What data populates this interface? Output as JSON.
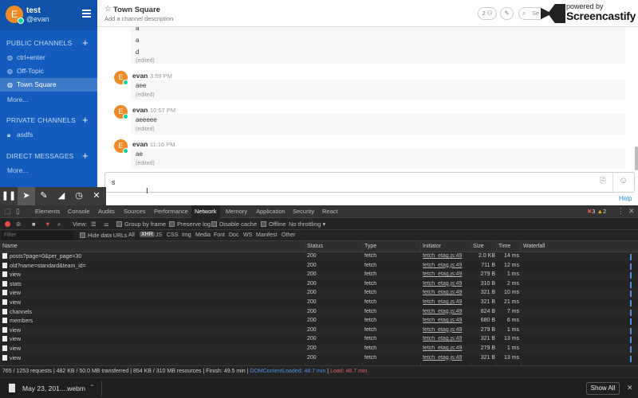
{
  "sidebar": {
    "team": "test",
    "user": "@evan",
    "avatar_letter": "E",
    "public_header": "PUBLIC CHANNELS",
    "public_channels": [
      "ctrl+enter",
      "Off-Topic",
      "Town Square"
    ],
    "private_header": "PRIVATE CHANNELS",
    "private_channels": [
      "asdfs"
    ],
    "direct_header": "DIRECT MESSAGES",
    "more": "More...",
    "plus": "+"
  },
  "channel": {
    "title": "Town Square",
    "description": "Add a channel description",
    "member_count": "2",
    "search_placeholder": "Se"
  },
  "watermark": {
    "powered": "powered by",
    "name": "Screencastify"
  },
  "posts": {
    "top_lines": [
      "a",
      "a",
      "d"
    ],
    "edited": "(edited)",
    "items": [
      {
        "author": "evan",
        "time": "3:59 PM",
        "text": "aee"
      },
      {
        "author": "evan",
        "time": "10:57 PM",
        "text": "aeeeee"
      },
      {
        "author": "evan",
        "time": "11:16 PM",
        "text": "ae"
      }
    ]
  },
  "composer": {
    "value": "s",
    "help": "Help"
  },
  "devtools": {
    "tabs": [
      "Elements",
      "Console",
      "Audits",
      "Sources",
      "Performance",
      "Network",
      "Memory",
      "Application",
      "Security",
      "React"
    ],
    "active_tab": "Network",
    "errors": "3",
    "warnings": "2",
    "toolbar": {
      "view": "View:",
      "group": "Group by frame",
      "preserve": "Preserve log",
      "disable_cache": "Disable cache",
      "offline": "Offline",
      "throttle": "No throttling"
    },
    "filter_placeholder": "Filter",
    "filter_types": [
      "Hide data URLs",
      "All",
      "XHR",
      "JS",
      "CSS",
      "Img",
      "Media",
      "Font",
      "Doc",
      "WS",
      "Manifest",
      "Other"
    ],
    "columns": [
      "Name",
      "Status",
      "Type",
      "Initiator",
      "Size",
      "Time",
      "Waterfall"
    ],
    "rows": [
      [
        "posts?page=0&per_page=30",
        "200",
        "fetch",
        "fetch_etag.js:49",
        "2.0 KB",
        "14 ms"
      ],
      [
        "old?name=standard&team_id=",
        "200",
        "fetch",
        "fetch_etag.js:49",
        "711 B",
        "12 ms"
      ],
      [
        "view",
        "200",
        "fetch",
        "fetch_etag.js:49",
        "279 B",
        "1 ms"
      ],
      [
        "stats",
        "200",
        "fetch",
        "fetch_etag.js:49",
        "310 B",
        "2 ms"
      ],
      [
        "view",
        "200",
        "fetch",
        "fetch_etag.js:49",
        "321 B",
        "10 ms"
      ],
      [
        "view",
        "200",
        "fetch",
        "fetch_etag.js:49",
        "321 B",
        "21 ms"
      ],
      [
        "channels",
        "200",
        "fetch",
        "fetch_etag.js:49",
        "824 B",
        "7 ms"
      ],
      [
        "members",
        "200",
        "fetch",
        "fetch_etag.js:49",
        "680 B",
        "6 ms"
      ],
      [
        "view",
        "200",
        "fetch",
        "fetch_etag.js:49",
        "279 B",
        "1 ms"
      ],
      [
        "view",
        "200",
        "fetch",
        "fetch_etag.js:49",
        "321 B",
        "13 ms"
      ],
      [
        "view",
        "200",
        "fetch",
        "fetch_etag.js:49",
        "279 B",
        "1 ms"
      ],
      [
        "view",
        "200",
        "fetch",
        "fetch_etag.js:49",
        "321 B",
        "13 ms"
      ]
    ],
    "status_summary": "765 / 1253 requests | 482 KB / 50.0 MB transferred | 854 KB / 310 MB resources | Finish: 49.5 min | ",
    "dom_loaded": "DOMContentLoaded: 48.7 min",
    "sep": " | ",
    "load": "Load: 48.7 min"
  },
  "download": {
    "file": "May 23, 201....webm",
    "show_all": "Show All"
  }
}
